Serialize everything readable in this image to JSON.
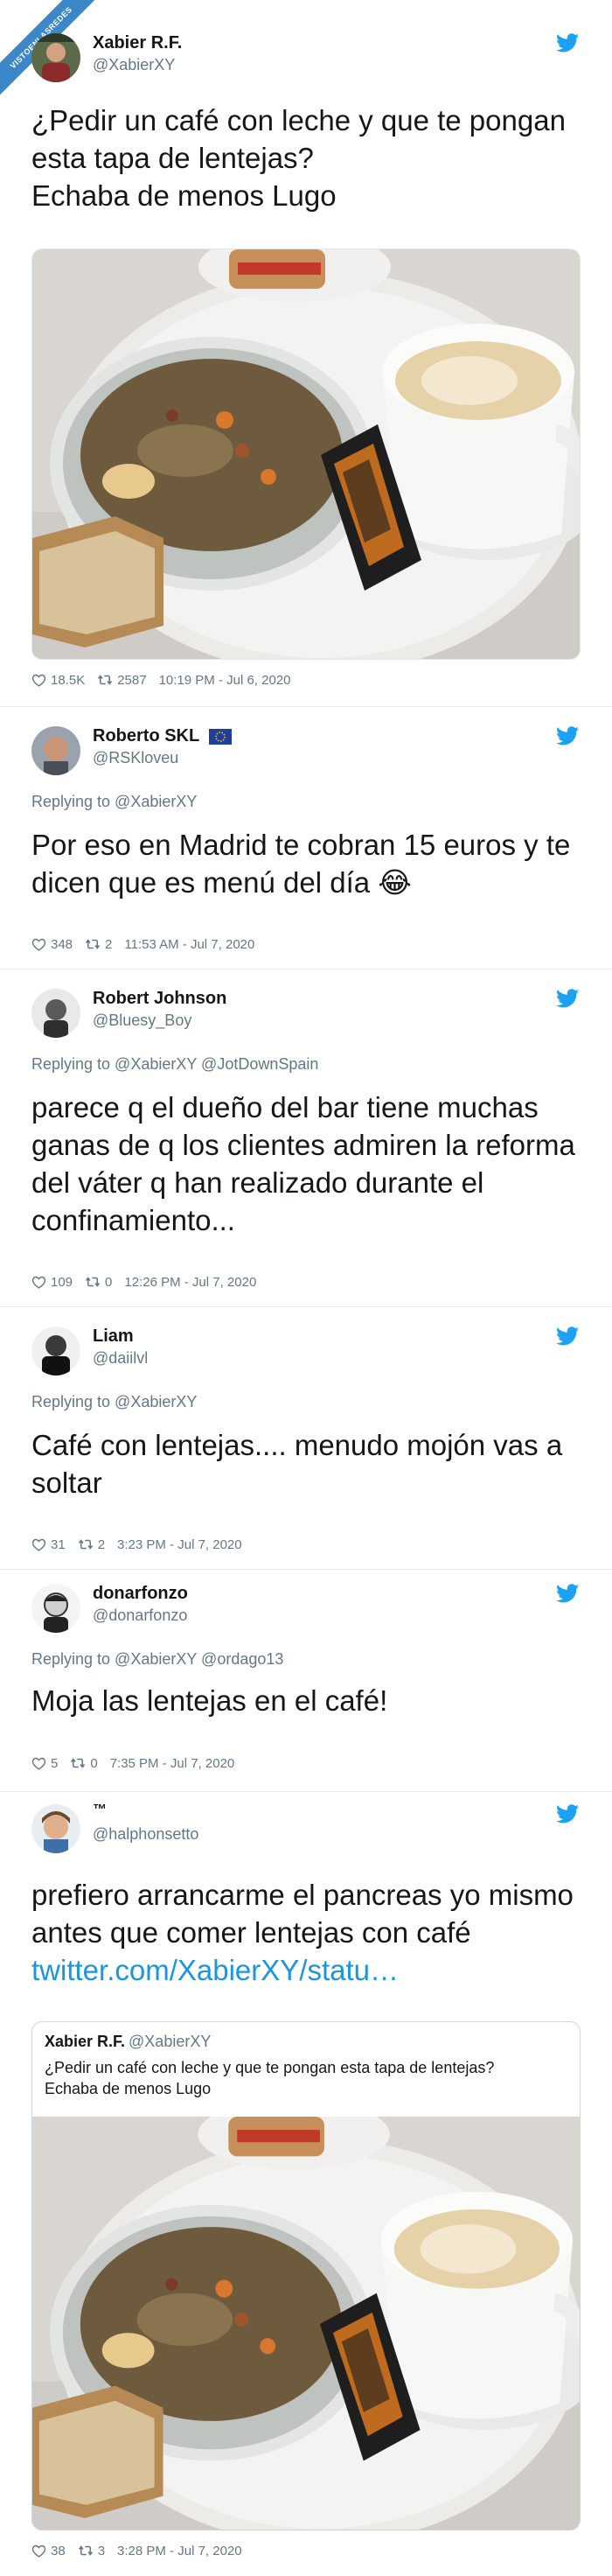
{
  "badge": "VISTOENLASREDES",
  "tweets": [
    {
      "name": "Xabier R.F.",
      "handle": "@XabierXY",
      "text_lines": [
        "¿Pedir un café con leche y que te pongan",
        "esta tapa de lentejas?",
        "Echaba de menos Lugo"
      ],
      "likes": "18.5K",
      "retweets": "2587",
      "time": "10:19 PM - Jul 6, 2020"
    },
    {
      "name": "Roberto SKL",
      "handle": "@RSKloveu",
      "reply": "Replying to @XabierXY",
      "text_lines": [
        "Por eso en Madrid te cobran 15 euros y te",
        "dicen que es menú del día 😂"
      ],
      "likes": "348",
      "retweets": "2",
      "time": "11:53 AM - Jul 7, 2020"
    },
    {
      "name": "Robert Johnson",
      "handle": "@Bluesy_Boy",
      "reply": "Replying to @XabierXY @JotDownSpain",
      "text_lines": [
        "parece q el dueño del bar tiene muchas",
        "ganas de q los clientes admiren la reforma",
        "del váter q han realizado durante el",
        "confinamiento..."
      ],
      "likes": "109",
      "retweets": "0",
      "time": "12:26 PM - Jul 7, 2020"
    },
    {
      "name": "Liam",
      "handle": "@daiilvl",
      "reply": "Replying to @XabierXY",
      "text_lines": [
        "Café con lentejas.... menudo mojón vas a",
        "soltar"
      ],
      "likes": "31",
      "retweets": "2",
      "time": "3:23 PM - Jul 7, 2020"
    },
    {
      "name": "donarfonzo",
      "handle": "@donarfonzo",
      "reply": "Replying to @XabierXY @ordago13",
      "text_lines": [
        "Moja las lentejas en el café!"
      ],
      "likes": "5",
      "retweets": "0",
      "time": "7:35 PM - Jul 7, 2020"
    },
    {
      "name": "™",
      "handle": "@halphonsetto",
      "text_lines": [
        "prefiero arrancarme el pancreas yo mismo",
        "antes que comer lentejas con café"
      ],
      "link": "twitter.com/XabierXY/statu…",
      "quote": {
        "name": "Xabier R.F.",
        "handle": "@XabierXY",
        "text_lines": [
          "¿Pedir un café con leche y que te pongan esta tapa de lentejas?",
          "Echaba de menos Lugo"
        ]
      },
      "likes": "38",
      "retweets": "3",
      "time": "3:28 PM - Jul 7, 2020"
    }
  ]
}
